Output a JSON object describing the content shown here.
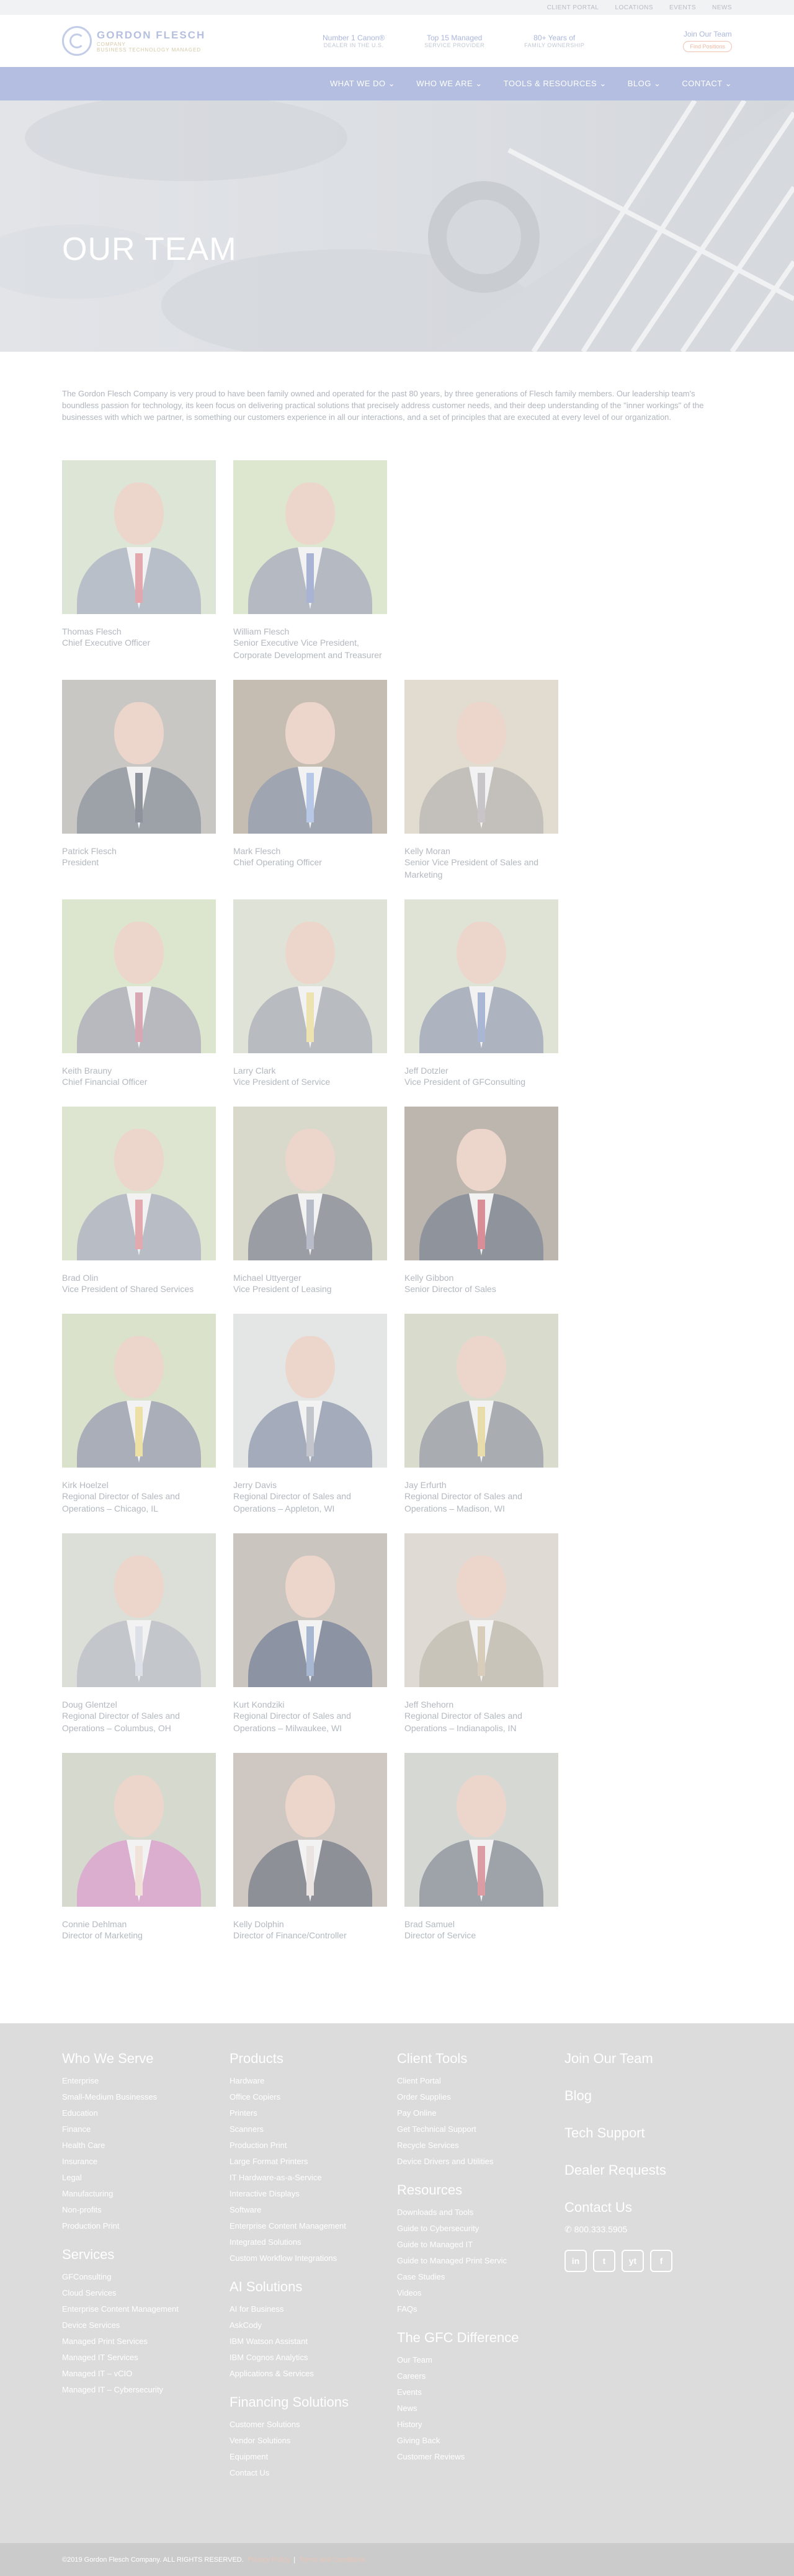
{
  "topbar": [
    "CLIENT PORTAL",
    "LOCATIONS",
    "EVENTS",
    "NEWS"
  ],
  "logo": {
    "name": "GORDON FLESCH",
    "company": "COMPANY",
    "tagline": "BUSINESS TECHNOLOGY MANAGED"
  },
  "stats": [
    {
      "a": "Number 1 Canon®",
      "b": "Dealer in the U.S."
    },
    {
      "a": "Top 15 Managed",
      "b": "Service Provider"
    },
    {
      "a": "80+ Years of",
      "b": "Family Ownership"
    }
  ],
  "join": {
    "label": "Join Our Team",
    "button": "Find Positions"
  },
  "nav": [
    "WHAT WE DO ⌄",
    "WHO WE ARE ⌄",
    "TOOLS & RESOURCES ⌄",
    "BLOG ⌄",
    "CONTACT ⌄"
  ],
  "hero": {
    "title": "OUR TEAM"
  },
  "intro": "The Gordon Flesch Company is very proud to have been family owned and operated for the past 80 years, by three generations of Flesch family members. Our leadership team's boundless passion for technology, its keen focus on delivering practical solutions that precisely address customer needs, and their deep understanding of the \"inner workings\" of the businesses with which we partner, is something our customers experience in all our interactions, and a set of principles that are executed at every level of our organization.",
  "members": [
    [
      {
        "name": "Thomas Flesch",
        "title": "Chief Executive Officer",
        "bg": "#dde5d6",
        "suit": "#b9bfc8",
        "tie": "#e3a8ae"
      },
      {
        "name": "William Flesch",
        "title": "Senior Executive Vice President, Corporate Development and Treasurer",
        "bg": "#dde6cf",
        "suit": "#b4b9c2",
        "tie": "#a9b4d4"
      }
    ],
    [
      {
        "name": "Patrick Flesch",
        "title": "President",
        "bg": "#c9c7c4",
        "suit": "#9da1a8",
        "tie": "#8f939b"
      },
      {
        "name": "Mark Flesch",
        "title": "Chief Operating Officer",
        "bg": "#c6bdb2",
        "suit": "#9fa5b1",
        "tie": "#b7c8e6"
      },
      {
        "name": "Kelly Moran",
        "title": "Senior Vice President of Sales and Marketing",
        "bg": "#e1dccf",
        "suit": "#c3c0bb",
        "tie": "#c8c5c8"
      }
    ],
    [
      {
        "name": "Keith Brauny",
        "title": "Chief Financial Officer",
        "bg": "#dce6cf",
        "suit": "#b7b9bf",
        "tie": "#d7a8b4"
      },
      {
        "name": "Larry Clark",
        "title": "Vice President of Service",
        "bg": "#dfe3d7",
        "suit": "#b8bbc0",
        "tie": "#ece3b0"
      },
      {
        "name": "Jeff Dotzler",
        "title": "Vice President of GFConsulting",
        "bg": "#dfe3d5",
        "suit": "#aeb3c0",
        "tie": "#a9b6d4"
      }
    ],
    [
      {
        "name": "Brad Olin",
        "title": "Vice President of Shared Services",
        "bg": "#dde4cf",
        "suit": "#b8bcc4",
        "tie": "#e2a9ae"
      },
      {
        "name": "Michael Uttyerger",
        "title": "Vice President of Leasing",
        "bg": "#d8d8cb",
        "suit": "#9a9da3",
        "tie": "#b7bcc8"
      },
      {
        "name": "Kelly Gibbon",
        "title": "Senior Director of Sales",
        "bg": "#bdb6ae",
        "suit": "#8f939b",
        "tie": "#d98d96"
      }
    ],
    [
      {
        "name": "Kirk Hoelzel",
        "title": "Regional Director of Sales and Operations – Chicago, IL",
        "bg": "#dbe2cc",
        "suit": "#a9aeb8",
        "tie": "#ece0a6"
      },
      {
        "name": "Jerry Davis",
        "title": "Regional Director of Sales and Operations – Appleton, WI",
        "bg": "#e3e6e4",
        "suit": "#a4abba",
        "tie": "#c2c5cc"
      },
      {
        "name": "Jay Erfurth",
        "title": "Regional Director of Sales and Operations – Madison, WI",
        "bg": "#d9dccd",
        "suit": "#a9adb2",
        "tie": "#e7dcaa"
      }
    ],
    [
      {
        "name": "Doug Glentzel",
        "title": "Regional Director of Sales and Operations – Columbus, OH",
        "bg": "#dcdfd8",
        "suit": "#c3c7cc",
        "tie": "#dde1e7"
      },
      {
        "name": "Kurt Kondziki",
        "title": "Regional Director of Sales and Operations – Milwaukee, WI",
        "bg": "#cbc5bf",
        "suit": "#8c93a3",
        "tie": "#a7b6d1"
      },
      {
        "name": "Jeff Shehorn",
        "title": "Regional Director of Sales and Operations – Indianapolis, IN",
        "bg": "#dfdbd4",
        "suit": "#c9c4b9",
        "tie": "#d8cdbb"
      }
    ],
    [
      {
        "name": "Connie Dehlman",
        "title": "Director of Marketing",
        "bg": "#d6d9cd",
        "suit": "#dbaed0",
        "tie": "#f1e2d9"
      },
      {
        "name": "Kelly Dolphin",
        "title": "Director of Finance/Controller",
        "bg": "#cfc8c2",
        "suit": "#8e9098",
        "tie": "#e9e4e2"
      },
      {
        "name": "Brad Samuel",
        "title": "Director of Service",
        "bg": "#d6d8d4",
        "suit": "#9ea2a9",
        "tie": "#dc9ca3"
      }
    ]
  ],
  "footer": {
    "col1": [
      {
        "heading": "Who We Serve",
        "items": [
          "Enterprise",
          "Small-Medium Businesses",
          "Education",
          "Finance",
          "Health Care",
          "Insurance",
          "Legal",
          "Manufacturing",
          "Non-profits",
          "Production Print"
        ]
      },
      {
        "heading": "Services",
        "items": [
          "GFConsulting",
          "Cloud Services",
          "Enterprise Content Management",
          "Device Services",
          "Managed Print Services",
          "Managed IT Services",
          "Managed IT – vCIO",
          "Managed IT – Cybersecurity"
        ]
      }
    ],
    "col2": [
      {
        "heading": "Products",
        "items": [
          "Hardware",
          "Office Copiers",
          "Printers",
          "Scanners",
          "Production Print",
          "Large Format Printers",
          "IT Hardware-as-a-Service",
          "Interactive Displays",
          "Software",
          "Enterprise Content Management",
          "Integrated Solutions",
          "Custom Workflow Integrations"
        ]
      },
      {
        "heading": "AI Solutions",
        "items": [
          "AI for Business",
          "AskCody",
          "IBM Watson Assistant",
          "IBM Cognos Analytics",
          "Applications & Services"
        ]
      },
      {
        "heading": "Financing Solutions",
        "items": [
          "Customer Solutions",
          "Vendor Solutions",
          "Equipment",
          "Contact Us"
        ]
      }
    ],
    "col3": [
      {
        "heading": "Client Tools",
        "items": [
          "Client Portal",
          "Order Supplies",
          "Pay Online",
          "Get Technical Support",
          "Recycle Services",
          "Device Drivers and Utilities"
        ]
      },
      {
        "heading": "Resources",
        "items": [
          "Downloads and Tools",
          "Guide to Cybersecurity",
          "Guide to Managed IT",
          "Guide to Managed Print Servic",
          "Case Studies",
          "Videos",
          "FAQs"
        ]
      },
      {
        "heading": "The GFC Difference",
        "items": [
          "Our Team",
          "Careers",
          "Events",
          "News",
          "History",
          "Giving Back",
          "Customer Reviews"
        ]
      }
    ],
    "col4": [
      "Join Our Team",
      "Blog",
      "Tech Support",
      "Dealer Requests",
      "Contact Us"
    ],
    "phone": "✆ 800.333.5905",
    "social": [
      "in",
      "t",
      "yt",
      "f"
    ]
  },
  "copyright": {
    "text": "©2019 Gordon Flesch Company. ALL RIGHTS RESERVED.",
    "links": [
      "Privacy Policy",
      "Terms and Conditions"
    ]
  }
}
